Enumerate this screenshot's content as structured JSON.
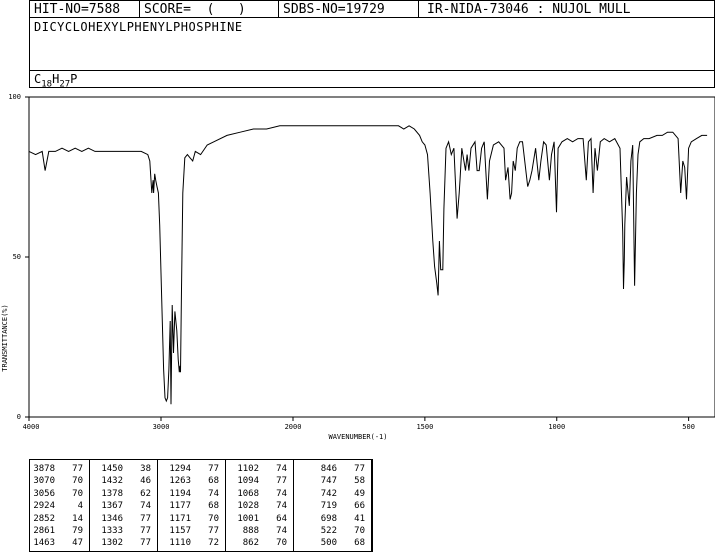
{
  "header": {
    "hit_no": "HIT-NO=7588",
    "score": "SCORE=  (   )",
    "sdbs_no": "SDBS-NO=19729",
    "ir_nida": "IR-NIDA-73046 : NUJOL MULL"
  },
  "compound_name": "DICYCLOHEXYLPHENYLPHOSPHINE",
  "formula": {
    "c": "C",
    "c_sub": "18",
    "h": "H",
    "h_sub": "27",
    "p": "P"
  },
  "chart_data": {
    "type": "line",
    "xlabel": "WAVENUMBER(-1)",
    "ylabel": "TRANSMITTANCE(%)",
    "xlim": [
      4000,
      400
    ],
    "ylim": [
      0,
      100
    ],
    "x_ticks": [
      4000,
      3000,
      2000,
      1500,
      1000,
      500
    ],
    "y_ticks": [
      0,
      50,
      100
    ],
    "grid": false,
    "x": [
      4000,
      3950,
      3900,
      3878,
      3850,
      3800,
      3750,
      3700,
      3650,
      3600,
      3550,
      3500,
      3450,
      3400,
      3350,
      3300,
      3250,
      3200,
      3150,
      3100,
      3085,
      3070,
      3060,
      3056,
      3048,
      3040,
      3030,
      3020,
      3010,
      3000,
      2990,
      2980,
      2970,
      2960,
      2950,
      2940,
      2930,
      2924,
      2915,
      2905,
      2895,
      2880,
      2870,
      2861,
      2856,
      2852,
      2845,
      2835,
      2820,
      2800,
      2780,
      2760,
      2740,
      2700,
      2650,
      2600,
      2500,
      2400,
      2300,
      2200,
      2100,
      2000,
      1900,
      1800,
      1700,
      1650,
      1600,
      1580,
      1560,
      1540,
      1520,
      1510,
      1500,
      1490,
      1480,
      1470,
      1463,
      1455,
      1450,
      1445,
      1440,
      1432,
      1428,
      1420,
      1410,
      1400,
      1390,
      1378,
      1370,
      1367,
      1360,
      1346,
      1340,
      1333,
      1325,
      1310,
      1302,
      1294,
      1285,
      1275,
      1263,
      1255,
      1240,
      1220,
      1200,
      1194,
      1185,
      1177,
      1171,
      1165,
      1157,
      1150,
      1140,
      1130,
      1110,
      1102,
      1094,
      1080,
      1068,
      1060,
      1050,
      1040,
      1028,
      1020,
      1010,
      1001,
      995,
      980,
      960,
      940,
      920,
      900,
      888,
      880,
      870,
      862,
      855,
      846,
      835,
      820,
      800,
      780,
      760,
      750,
      747,
      744,
      742,
      735,
      725,
      719,
      712,
      705,
      698,
      692,
      685,
      670,
      650,
      620,
      600,
      580,
      560,
      540,
      530,
      522,
      515,
      508,
      500,
      490,
      470,
      450,
      430,
      400
    ],
    "y": [
      83,
      82,
      83,
      77,
      83,
      83,
      84,
      83,
      84,
      83,
      84,
      83,
      83,
      83,
      83,
      83,
      83,
      83,
      83,
      82,
      80,
      70,
      74,
      70,
      76,
      74,
      72,
      70,
      60,
      45,
      30,
      15,
      6,
      5,
      6,
      15,
      30,
      4,
      35,
      20,
      33,
      27,
      18,
      14,
      16,
      14,
      40,
      70,
      81,
      82,
      81,
      80,
      83,
      82,
      85,
      86,
      88,
      89,
      90,
      90,
      91,
      91,
      91,
      91,
      91,
      91,
      91,
      90,
      91,
      90,
      88,
      86,
      85,
      82,
      70,
      55,
      47,
      42,
      38,
      55,
      46,
      46,
      65,
      84,
      86,
      82,
      84,
      62,
      70,
      74,
      84,
      77,
      82,
      77,
      84,
      86,
      77,
      77,
      84,
      86,
      68,
      80,
      85,
      86,
      84,
      74,
      78,
      68,
      70,
      80,
      77,
      84,
      86,
      86,
      72,
      74,
      77,
      84,
      74,
      80,
      86,
      85,
      74,
      82,
      86,
      64,
      84,
      86,
      87,
      86,
      87,
      87,
      74,
      86,
      87,
      70,
      84,
      77,
      86,
      87,
      86,
      87,
      84,
      58,
      40,
      49,
      60,
      75,
      66,
      80,
      85,
      41,
      70,
      82,
      86,
      87,
      87,
      88,
      88,
      89,
      89,
      87,
      70,
      80,
      78,
      68,
      84,
      86,
      87,
      88,
      88
    ]
  },
  "peaks": [
    [
      [
        "3878",
        "77"
      ],
      [
        "3070",
        "70"
      ],
      [
        "3056",
        "70"
      ],
      [
        "2924",
        "4"
      ],
      [
        "2852",
        "14"
      ],
      [
        "2861",
        "79"
      ],
      [
        "1463",
        "47"
      ]
    ],
    [
      [
        "1450",
        "38"
      ],
      [
        "1432",
        "46"
      ],
      [
        "1378",
        "62"
      ],
      [
        "1367",
        "74"
      ],
      [
        "1346",
        "77"
      ],
      [
        "1333",
        "77"
      ],
      [
        "1302",
        "77"
      ]
    ],
    [
      [
        "1294",
        "77"
      ],
      [
        "1263",
        "68"
      ],
      [
        "1194",
        "74"
      ],
      [
        "1177",
        "68"
      ],
      [
        "1171",
        "70"
      ],
      [
        "1157",
        "77"
      ],
      [
        "1110",
        "72"
      ]
    ],
    [
      [
        "1102",
        "74"
      ],
      [
        "1094",
        "77"
      ],
      [
        "1068",
        "74"
      ],
      [
        "1028",
        "74"
      ],
      [
        "1001",
        "64"
      ],
      [
        "888",
        "74"
      ],
      [
        "862",
        "70"
      ]
    ],
    [
      [
        "846",
        "77"
      ],
      [
        "747",
        "58"
      ],
      [
        "742",
        "49"
      ],
      [
        "719",
        "66"
      ],
      [
        "698",
        "41"
      ],
      [
        "522",
        "70"
      ],
      [
        "500",
        "68"
      ]
    ]
  ]
}
